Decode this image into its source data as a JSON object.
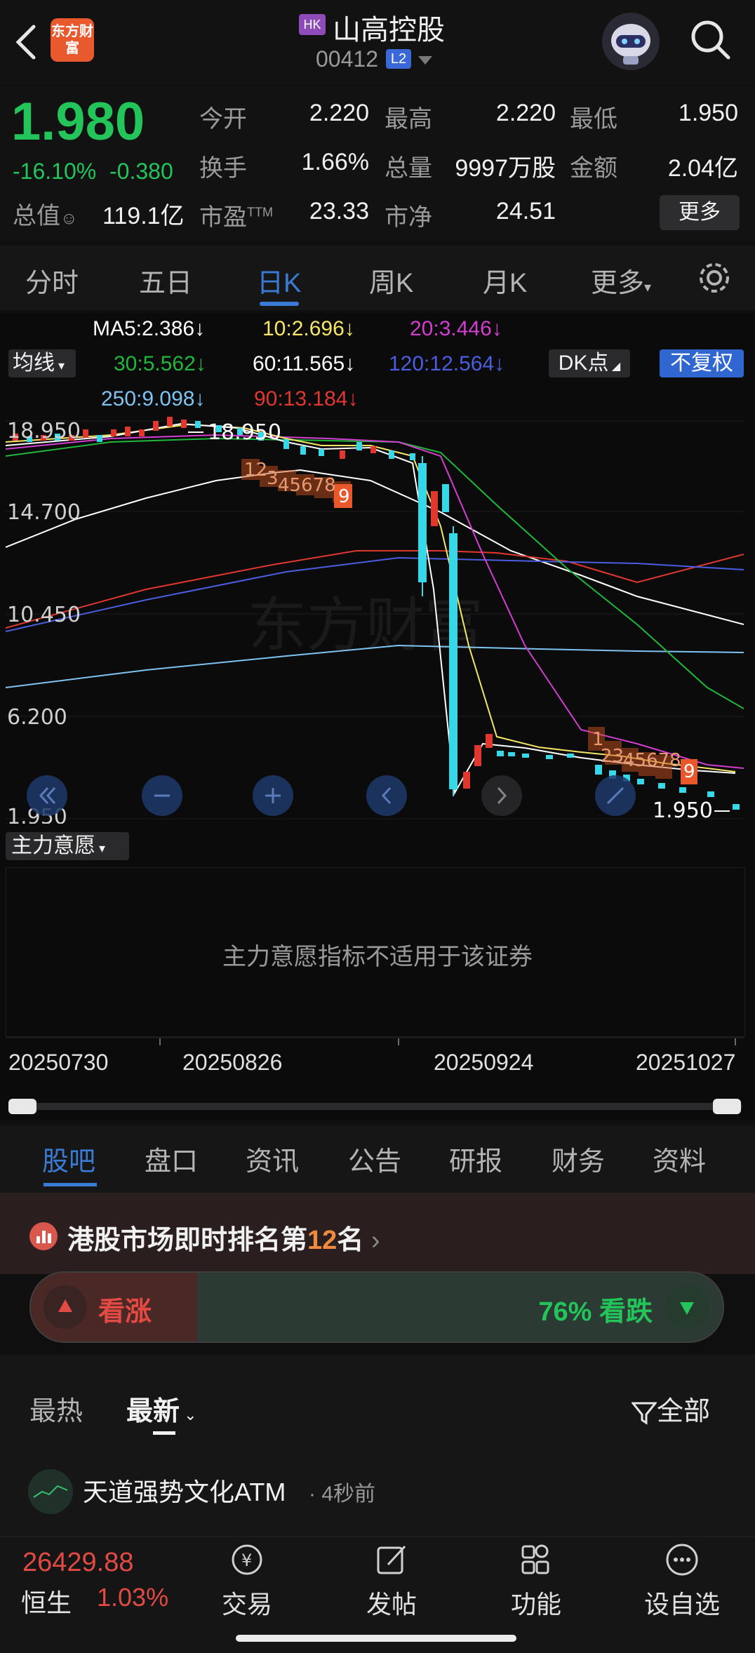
{
  "header": {
    "logo_text": "东方财富",
    "market_badge": "HK",
    "stock_name": "山高控股",
    "stock_code": "00412",
    "level_badge": "L2"
  },
  "quote": {
    "price": "1.980",
    "change_pct": "-16.10%",
    "change_abs": "-0.380",
    "market_cap_label": "总值",
    "market_cap": "119.1亿",
    "open_label": "今开",
    "open": "2.220",
    "high_label": "最高",
    "high": "2.220",
    "low_label": "最低",
    "low": "1.950",
    "turnover_label": "换手",
    "turnover": "1.66%",
    "volume_label": "总量",
    "volume": "9997万股",
    "amount_label": "金额",
    "amount": "2.04亿",
    "pe_label": "市盈",
    "pe_sup": "TTM",
    "pe": "23.33",
    "pb_label": "市净",
    "pb": "24.51",
    "more_label": "更多"
  },
  "period_tabs": [
    "分时",
    "五日",
    "日K",
    "周K",
    "月K",
    "更多"
  ],
  "period_active": "日K",
  "indicators": {
    "ma5": "MA5:2.386↓",
    "ma10": "10:2.696↓",
    "ma20": "20:3.446↓",
    "ma30": "30:5.562↓",
    "ma60": "60:11.565↓",
    "ma120": "120:12.564↓",
    "ma250": "250:9.098↓",
    "ma90": "90:13.184↓",
    "ma_toggle": "均线",
    "dk_button": "DK点",
    "adjust_button": "不复权",
    "colors": {
      "ma5": "#ffffff",
      "ma10": "#f5e663",
      "ma20": "#d23ed0",
      "ma30": "#1fb83a",
      "ma60": "#ffffff",
      "ma120": "#4b5de0",
      "ma250": "#7ec3f2",
      "ma90": "#e0372f"
    }
  },
  "chart": {
    "price_labels": [
      "18.950",
      "14.700",
      "10.450",
      "6.200",
      "1.950"
    ],
    "high_marker": "18.950",
    "low_marker": "1.950",
    "watermark": "东方财富",
    "td_seq_top": [
      "1",
      "2",
      "3",
      "4",
      "5",
      "6",
      "7",
      "8",
      "9"
    ],
    "td_seq_bottom": [
      "1",
      "2",
      "3",
      "4",
      "5",
      "6",
      "7",
      "8",
      "9"
    ],
    "dates": [
      "20250730",
      "20250826",
      "20250924",
      "20251027"
    ]
  },
  "indicator_panel": {
    "selector": "主力意愿",
    "message": "主力意愿指标不适用于该证券"
  },
  "content_tabs": [
    "股吧",
    "盘口",
    "资讯",
    "公告",
    "研报",
    "财务",
    "资料"
  ],
  "content_active": "股吧",
  "rank": {
    "prefix": "港股市场即时排名第",
    "rank": "12",
    "suffix": "名"
  },
  "sentiment": {
    "bull_label": "看涨",
    "bear_label": "76% 看跌",
    "bear_fraction": 0.76
  },
  "feed": {
    "tab_hot": "最热",
    "tab_new": "最新",
    "filter": "全部",
    "post_user": "天道强势文化ATM",
    "post_time": "4秒前"
  },
  "bottom": {
    "index_value": "26429.88",
    "index_name": "恒生",
    "index_pct": "1.03%",
    "nav": [
      "交易",
      "发帖",
      "功能",
      "设自选"
    ]
  }
}
